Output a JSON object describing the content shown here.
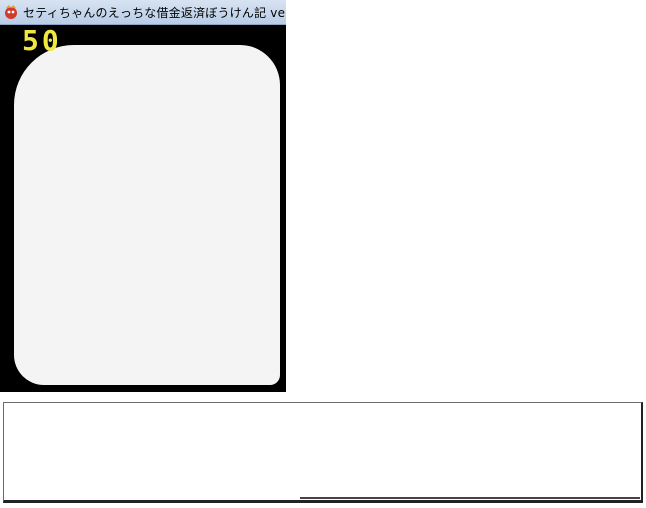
{
  "window": {
    "title": "セティちゃんのえっちな借金返済ぼうけん記 ver"
  },
  "hud": {
    "counter": "50"
  },
  "scene": {
    "placeholder_note": ""
  },
  "message_box": {
    "text": ""
  },
  "colors": {
    "titlebar": "#c6d6ec",
    "counter": "#f2e640",
    "stage": "#000000"
  }
}
